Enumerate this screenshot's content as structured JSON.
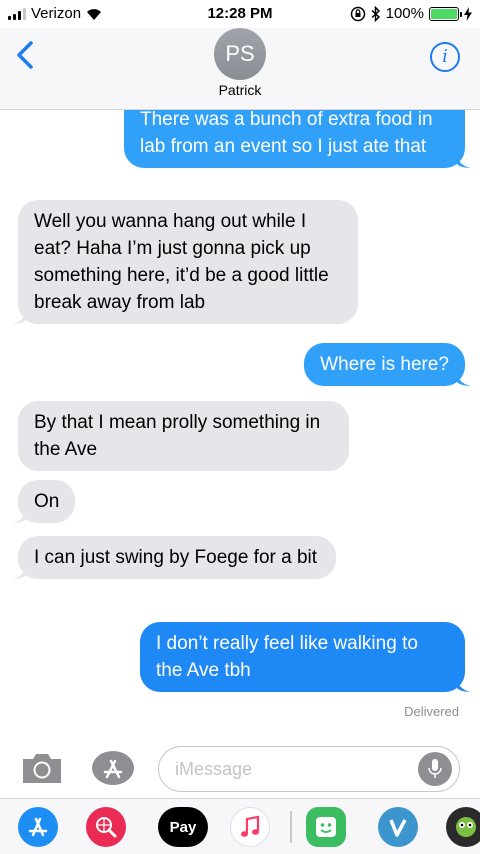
{
  "status_bar": {
    "carrier": "Verizon",
    "time": "12:28 PM",
    "battery": "100%"
  },
  "header": {
    "avatar_initials": "PS",
    "contact_name": "Patrick",
    "info_label": "i"
  },
  "messages": [
    {
      "direction": "out",
      "text": "There was a bunch of extra food in lab from an event so I just ate that"
    },
    {
      "direction": "in",
      "text": "Well you wanna hang out while I eat? Haha I’m just gonna pick up something here, it’d be a good little break away from lab"
    },
    {
      "direction": "out",
      "text": "Where is here?"
    },
    {
      "direction": "in",
      "text": "By that I mean prolly something in the Ave"
    },
    {
      "direction": "in",
      "text": "On"
    },
    {
      "direction": "in",
      "text": "I can just swing by Foege for a bit"
    },
    {
      "direction": "out",
      "text": "I don’t really feel like walking to the Ave tbh"
    }
  ],
  "delivered_label": "Delivered",
  "compose": {
    "placeholder": "iMessage"
  },
  "app_drawer": {
    "apple_pay_label": "Pay",
    "apps": [
      "app-store-icon",
      "web-search-icon",
      "apple-pay-icon",
      "music-icon",
      "sticker-app-icon",
      "venmo-icon",
      "game-app-icon"
    ]
  },
  "colors": {
    "accent": "#1d7cf2",
    "outgoing_bubble": "#1e88f5",
    "incoming_bubble": "#e5e5ea",
    "battery_fill": "#4cd964"
  }
}
